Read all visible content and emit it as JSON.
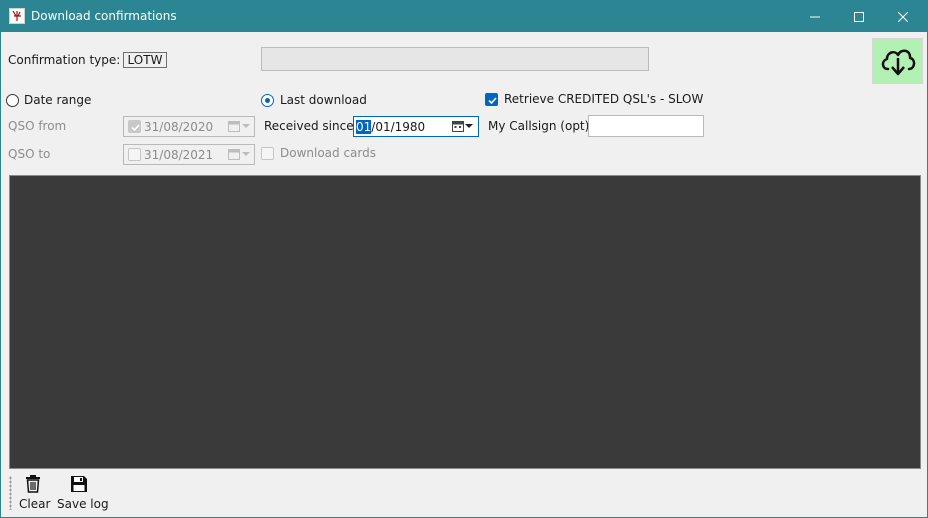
{
  "window": {
    "title": "Download confirmations",
    "minimize_icon": "minimize-icon",
    "maximize_icon": "maximize-icon",
    "close_icon": "close-icon"
  },
  "confirmation": {
    "label": "Confirmation type:",
    "value": "LOTW"
  },
  "progress": {
    "fraction": 0
  },
  "download_button": {
    "icon": "cloud-download-icon",
    "background": "#b3f0b3"
  },
  "options": {
    "date_range_label": "Date range",
    "date_range_selected": false,
    "last_download_label": "Last download",
    "last_download_selected": true,
    "retrieve_credited_label": "Retrieve CREDITED QSL's - SLOW",
    "retrieve_credited_checked": true
  },
  "qso_from": {
    "label": "QSO from",
    "checked": true,
    "value": "31/08/2020"
  },
  "qso_to": {
    "label": "QSO to",
    "checked": false,
    "value": "31/08/2021"
  },
  "received_since": {
    "label": "Received since",
    "value_selected": "01",
    "value_rest": "/01/1980"
  },
  "download_cards": {
    "label": "Download cards",
    "checked": false
  },
  "my_callsign": {
    "label": "My Callsign (opt)",
    "value": ""
  },
  "toolbar": {
    "clear_label": "Clear",
    "save_log_label": "Save log"
  },
  "colors": {
    "titlebar": "#2b8593",
    "accent": "#0067c0",
    "log_background": "#3a3a3a"
  }
}
